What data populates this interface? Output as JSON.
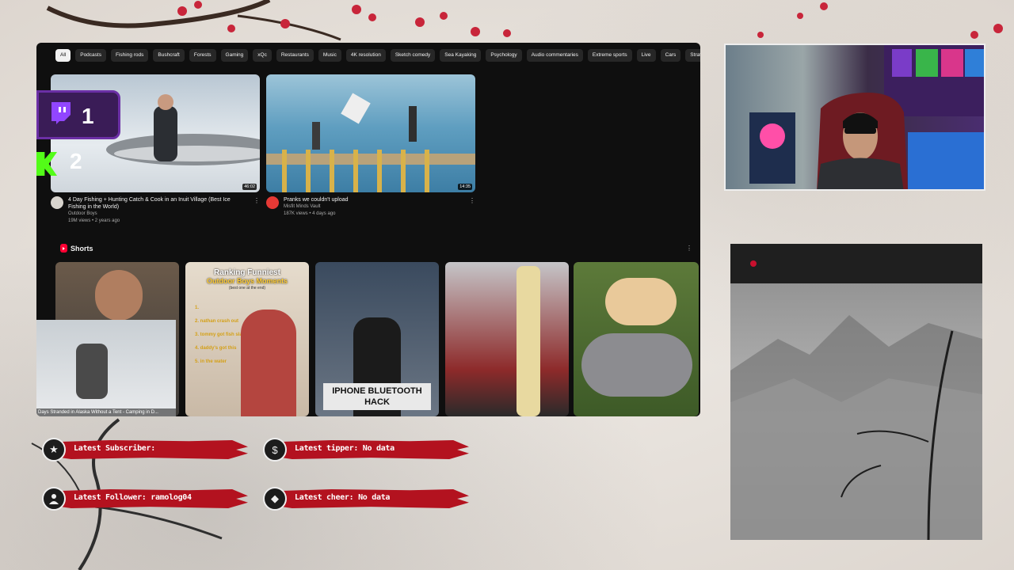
{
  "chips": [
    "All",
    "Podcasts",
    "Fishing rods",
    "Bushcraft",
    "Forests",
    "Gaming",
    "xQc",
    "Restaurants",
    "Music",
    "4K resolution",
    "Sketch comedy",
    "Sea Kayaking",
    "Psychology",
    "Audio commentaries",
    "Extreme sports",
    "Live",
    "Cars",
    "Strate"
  ],
  "videos": [
    {
      "title": "4 Day Fishing + Hunting Catch & Cook in an Inuit Village (Best Ice Fishing in the World)",
      "channel": "Outdoor Boys",
      "stats": "19M views • 2 years ago",
      "duration": "46:02"
    },
    {
      "title": "Pranks we couldn't upload",
      "channel": "Misfit Minds Vault",
      "stats": "187K views • 4 days ago",
      "duration": "14:35"
    }
  ],
  "shorts": {
    "title": "Shorts",
    "items": [
      {
        "caption": "Days Stranded in Alaska Without a Tent - Camping in D..."
      },
      {
        "overlay_title": "Ranking Funniest",
        "overlay_sub": "Outdoor Boys Moments",
        "overlay_note": "(best one at the end)",
        "list": [
          "1.",
          "2. nathan crash out",
          "3. tommy got fish slapped",
          "4. daddy's got this",
          "5. in the water"
        ]
      },
      {
        "overlay": "IPHONE BLUETOOTH HACK"
      },
      {},
      {}
    ]
  },
  "overlay_badges": {
    "rank1": "1",
    "rank2": "2"
  },
  "alerts": [
    {
      "icon": "star-icon",
      "text": "Latest Subscriber:"
    },
    {
      "icon": "dollar-icon",
      "text": "Latest tipper: No data"
    },
    {
      "icon": "user-icon",
      "text": "Latest Follower: ramolog04"
    },
    {
      "icon": "diamond-icon",
      "text": "Latest cheer: No data"
    }
  ],
  "colors": {
    "yt_bg": "#0f0f0f",
    "chip": "#272727",
    "accent_red": "#b3121f",
    "shorts_red": "#ff0033"
  }
}
